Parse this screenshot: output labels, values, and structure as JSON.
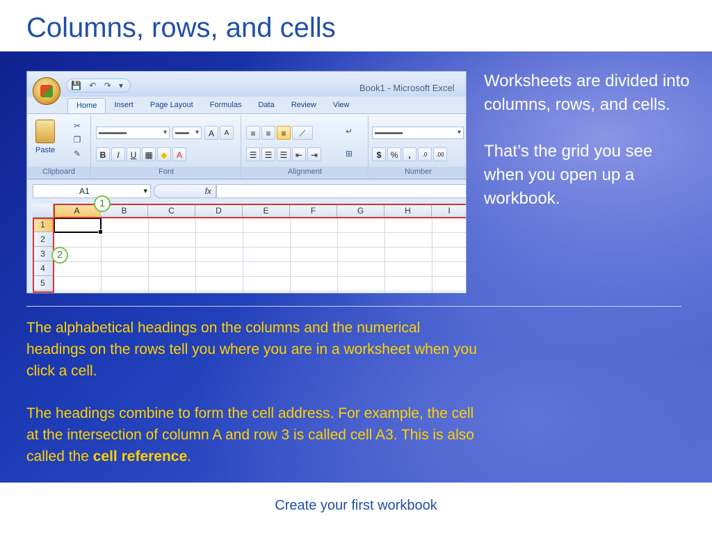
{
  "slide": {
    "title": "Columns, rows, and cells",
    "right_paragraphs": [
      "Worksheets are divided into columns, rows, and cells.",
      "That’s the grid you see when you open up a workbook."
    ],
    "bottom_paragraph_1": "The alphabetical headings on the columns and the numerical headings on the rows tell you where you are in a worksheet when you click a cell.",
    "bottom_paragraph_2_prefix": "The headings combine to form the cell address. For example, the cell at the intersection of column A and row 3 is called cell A3. This is also called the ",
    "bottom_paragraph_2_bold": "cell reference",
    "bottom_paragraph_2_suffix": ".",
    "footer": "Create your first workbook",
    "colors": {
      "title": "#1f4fa8",
      "body_text_yellow": "#ffd200",
      "panel_blue": "#1c3bb5"
    }
  },
  "excel": {
    "window_title": "Book1 - Microsoft Excel",
    "quick_access_toolbar": "💾 ↶ ↷ ▾",
    "tabs": [
      "Home",
      "Insert",
      "Page Layout",
      "Formulas",
      "Data",
      "Review",
      "View"
    ],
    "groups": {
      "clipboard": "Clipboard",
      "font": "Font",
      "alignment": "Alignment",
      "number": "Number"
    },
    "paste_label": "Paste",
    "font_buttons": [
      "B",
      "I",
      "U"
    ],
    "font_size_buttons": [
      "A",
      "A"
    ],
    "number_buttons": [
      "$",
      "%",
      ","
    ],
    "decimal_buttons": [
      ".0",
      ".00"
    ],
    "name_box_value": "A1",
    "fx_label": "fx",
    "column_headers": [
      "A",
      "B",
      "C",
      "D",
      "E",
      "F",
      "G",
      "H",
      "I"
    ],
    "row_headers": [
      "1",
      "2",
      "3",
      "4",
      "5"
    ],
    "callouts": [
      "1",
      "2"
    ]
  }
}
